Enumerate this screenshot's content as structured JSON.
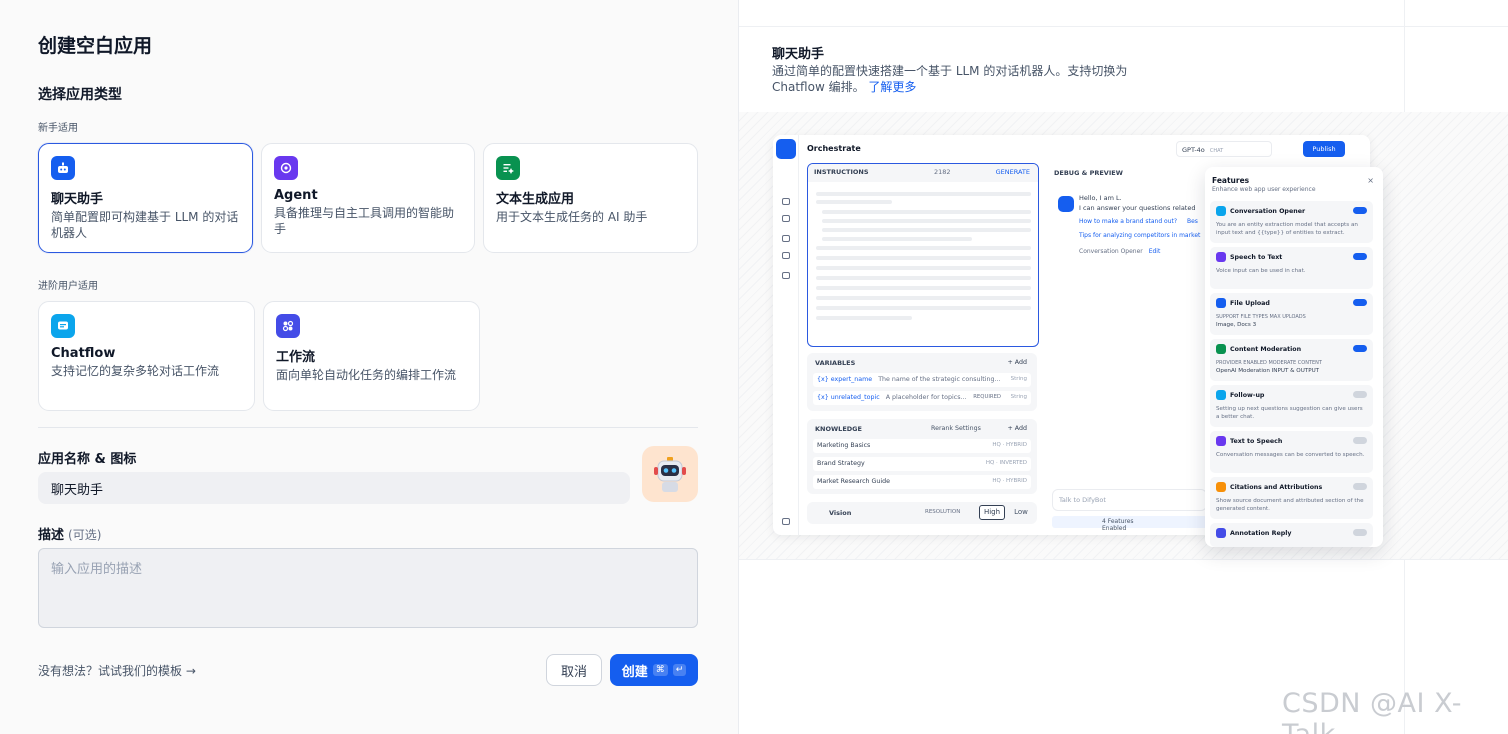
{
  "dialog": {
    "title": "创建空白应用",
    "select_type_label": "选择应用类型",
    "beginner_label": "新手适用",
    "advanced_label": "进阶用户适用",
    "beginner_types": [
      {
        "title": "聊天助手",
        "desc": "简单配置即可构建基于 LLM 的对话机器人",
        "icon": "chat-bot-icon",
        "color": "#155eef"
      },
      {
        "title": "Agent",
        "desc": "具备推理与自主工具调用的智能助手",
        "icon": "agent-icon",
        "color": "#6938ef"
      },
      {
        "title": "文本生成应用",
        "desc": "用于文本生成任务的 AI 助手",
        "icon": "text-gen-icon",
        "color": "#099250"
      }
    ],
    "advanced_types": [
      {
        "title": "Chatflow",
        "desc": "支持记忆的复杂多轮对话工作流",
        "icon": "chatflow-icon",
        "color": "#0ba5ec"
      },
      {
        "title": "工作流",
        "desc": "面向单轮自动化任务的编排工作流",
        "icon": "workflow-icon",
        "color": "#444ce7"
      }
    ],
    "name_icon_label": "应用名称 & 图标",
    "name_value": "聊天助手",
    "desc_label": "描述",
    "desc_optional": "(可选)",
    "desc_placeholder": "输入应用的描述",
    "template_link": "没有想法？试试我们的模板 →",
    "cancel_label": "取消",
    "create_label": "创建",
    "create_shortcut_1": "⌘",
    "create_shortcut_2": "↵"
  },
  "preview": {
    "title": "聊天助手",
    "desc": "通过简单的配置快速搭建一个基于 LLM 的对话机器人。支持切换为 Chatflow 编排。",
    "learn_more": "了解更多",
    "shot": {
      "header": "Orchestrate",
      "model": "GPT-4o",
      "model_tag": "CHAT",
      "publish": "Publish",
      "instructions": "INSTRUCTIONS",
      "instr_count": "2182",
      "generate": "GENERATE",
      "variables": "VARIABLES",
      "add": "+ Add",
      "vars": [
        {
          "name": "{x} expert_name",
          "desc": "The name of the strategic consulting...",
          "type": "String"
        },
        {
          "name": "{x} unrelated_topic",
          "desc": "A placeholder for topics...",
          "type": "String",
          "req": "REQUIRED"
        }
      ],
      "knowledge": "KNOWLEDGE",
      "rerank": "Rerank Settings",
      "docs": [
        {
          "name": "Marketing Basics",
          "tag": "HQ · HYBRID"
        },
        {
          "name": "Brand Strategy",
          "tag": "HQ · INVERTED"
        },
        {
          "name": "Market Research Guide",
          "tag": "HQ · HYBRID"
        }
      ],
      "vision": "Vision",
      "resolution": "RESOLUTION",
      "high": "High",
      "low": "Low",
      "debug": "DEBUG & PREVIEW",
      "chat_hello": "Hello, I am L.",
      "chat_line": "I can answer your questions related",
      "sug_1": "How to make a brand stand out?",
      "sug_1b": "Bes",
      "sug_2": "Tips for analyzing competitors in market",
      "opener": "Conversation Opener",
      "edit": "Edit",
      "talk": "Talk to DifyBot",
      "features_enabled": "4 Features Enabled",
      "features": {
        "title": "Features",
        "subtitle": "Enhance web app user experience",
        "close": "×",
        "items": [
          {
            "title": "Conversation Opener",
            "desc": "You are an entity extraction model that accepts an input text and {{type}} of entities to extract.",
            "color": "#0ba5ec",
            "on": true
          },
          {
            "title": "Speech to Text",
            "desc": "Voice input can be used in chat.",
            "color": "#6938ef",
            "on": true
          },
          {
            "title": "File Upload",
            "desc": "SUPPORT FILE TYPES   MAX UPLOADS",
            "desc2": "Image, Docs   3",
            "color": "#155eef",
            "on": true
          },
          {
            "title": "Content Moderation",
            "desc": "PROVIDER   ENABLED MODERATE CONTENT",
            "desc2": "OpenAI Moderation   INPUT & OUTPUT",
            "color": "#099250",
            "on": true
          },
          {
            "title": "Follow-up",
            "desc": "Setting up next questions suggestion can give users a better chat.",
            "color": "#0ba5ec",
            "on": false
          },
          {
            "title": "Text to Speech",
            "desc": "Conversation messages can be converted to speech.",
            "color": "#6938ef",
            "on": false
          },
          {
            "title": "Citations and Attributions",
            "desc": "Show source document and attributed section of the generated content.",
            "color": "#f79009",
            "on": false
          },
          {
            "title": "Annotation Reply",
            "desc": "",
            "color": "#444ce7",
            "on": false
          }
        ]
      }
    }
  },
  "watermark": "CSDN @AI X-Talk"
}
